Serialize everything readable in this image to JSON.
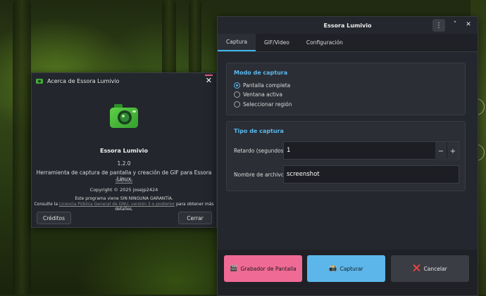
{
  "about_dialog": {
    "title": "Acerca de Essora Lumivio",
    "close_glyph": "✕",
    "app_name": "Essora Lumivio",
    "version": "1.2.0",
    "description": "Herramienta de captura de pantalla y creación de GIF para Essora Linux",
    "github_link": "GitHub",
    "copyright": "Copyright © 2025 josejp2424",
    "warranty": "Este programa viene SIN NINGUNA GARANTÍA.",
    "license_prefix": "Consulte la",
    "license_link": "Licencia Pública General de GNU, versión 3 o posterior",
    "license_suffix": "para obtener más detalles.",
    "credits_button": "Créditos",
    "close_button": "Cerrar"
  },
  "main_window": {
    "title": "Essora Lumivio",
    "menu_glyph": "⋮",
    "minimize_glyph": "˅",
    "close_glyph": "✕",
    "tabs": [
      {
        "label": "Captura",
        "active": true
      },
      {
        "label": "GIF/Video",
        "active": false
      },
      {
        "label": "Configuración",
        "active": false
      }
    ],
    "capture_mode": {
      "title": "Modo de captura",
      "options": [
        {
          "label": "Pantalla completa",
          "selected": true
        },
        {
          "label": "Ventana activa",
          "selected": false
        },
        {
          "label": "Seleccionar región",
          "selected": false
        }
      ]
    },
    "capture_type": {
      "title": "Tipo de captura",
      "delay_label": "Retardo (segundos)",
      "delay_value": "1",
      "decrement": "−",
      "increment": "+",
      "filename_label": "Nombre de archivo",
      "filename_value": "screenshot"
    },
    "actions": [
      {
        "icon": "🎬",
        "label": "Grabador de Pantalla",
        "color": "#f06a96"
      },
      {
        "icon": "📸",
        "label": "Capturar",
        "color": "#5cb6ea"
      },
      {
        "icon": "❌",
        "label": "Cancelar",
        "color": "#3a3d44"
      }
    ]
  },
  "colors": {
    "accent": "#59b9ef",
    "close_accent": "#e35b72",
    "icon_green": "#4cc43a"
  }
}
